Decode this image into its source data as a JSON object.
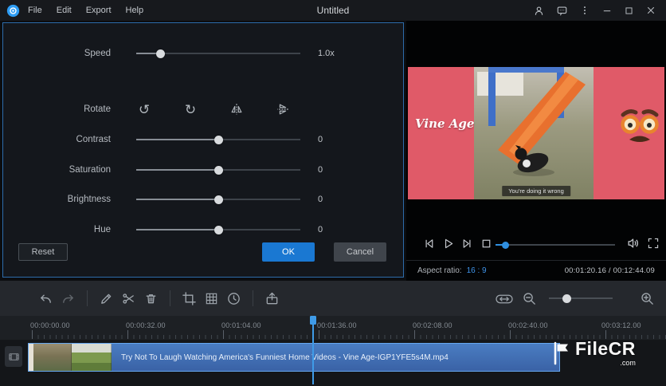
{
  "titlebar": {
    "menus": [
      "File",
      "Edit",
      "Export",
      "Help"
    ],
    "title": "Untitled"
  },
  "edit_panel": {
    "speed_label": "Speed",
    "speed_value": "1.0x",
    "rotate_label": "Rotate",
    "adjustments": [
      {
        "label": "Contrast",
        "value": "0"
      },
      {
        "label": "Saturation",
        "value": "0"
      },
      {
        "label": "Brightness",
        "value": "0"
      },
      {
        "label": "Hue",
        "value": "0"
      }
    ],
    "reset_label": "Reset",
    "ok_label": "OK",
    "cancel_label": "Cancel"
  },
  "preview": {
    "overlay_title": "Vine Age",
    "caption": "You're doing it wrong",
    "aspect_ratio_label": "Aspect ratio:",
    "aspect_ratio_value": "16 : 9",
    "time_display": "00:01:20.16 / 00:12:44.09"
  },
  "timeline": {
    "ruler_labels": [
      "00:00:00.00",
      "00:00:32.00",
      "00:01:04.00",
      "00:01:36.00",
      "00:02:08.00",
      "00:02:40.00",
      "00:03:12.00"
    ],
    "clip_name": "Try Not To Laugh Watching America's Funniest Home Videos - Vine Age-IGP1YFE5s4M.mp4"
  },
  "watermark": {
    "name": "FileCR",
    "domain": ".com"
  },
  "icons": {
    "rotate_left": "↺",
    "rotate_right": "↻"
  },
  "colors": {
    "accent": "#1a78d2",
    "panel_border": "#2d6cab",
    "clip_blue": "#3e6cb0",
    "vine_pink": "#e05a68",
    "playhead": "#3f9be8"
  }
}
